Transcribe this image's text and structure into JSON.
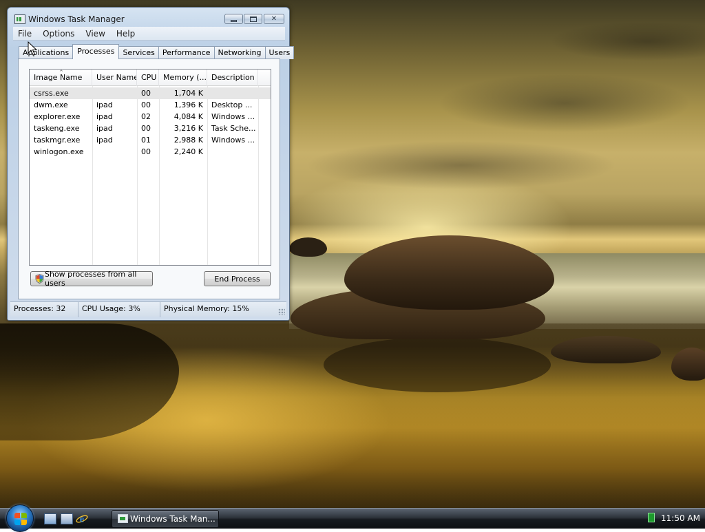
{
  "window": {
    "title": "Windows Task Manager",
    "icon": "task-manager-icon"
  },
  "menu": [
    "File",
    "Options",
    "View",
    "Help"
  ],
  "tabs": [
    {
      "label": "Applications",
      "active": false
    },
    {
      "label": "Processes",
      "active": true
    },
    {
      "label": "Services",
      "active": false
    },
    {
      "label": "Performance",
      "active": false
    },
    {
      "label": "Networking",
      "active": false
    },
    {
      "label": "Users",
      "active": false
    }
  ],
  "processes": {
    "columns": [
      "Image Name",
      "User Name",
      "CPU",
      "Memory (...",
      "Description"
    ],
    "sort_indicator": "^",
    "rows": [
      {
        "image": "csrss.exe",
        "user": "",
        "cpu": "00",
        "memory": "1,704 K",
        "description": "",
        "selected": true
      },
      {
        "image": "dwm.exe",
        "user": "ipad",
        "cpu": "00",
        "memory": "1,396 K",
        "description": "Desktop ...",
        "selected": false
      },
      {
        "image": "explorer.exe",
        "user": "ipad",
        "cpu": "02",
        "memory": "4,084 K",
        "description": "Windows ...",
        "selected": false
      },
      {
        "image": "taskeng.exe",
        "user": "ipad",
        "cpu": "00",
        "memory": "3,216 K",
        "description": "Task Sche...",
        "selected": false
      },
      {
        "image": "taskmgr.exe",
        "user": "ipad",
        "cpu": "01",
        "memory": "2,988 K",
        "description": "Windows ...",
        "selected": false
      },
      {
        "image": "winlogon.exe",
        "user": "",
        "cpu": "00",
        "memory": "2,240 K",
        "description": "",
        "selected": false
      }
    ]
  },
  "buttons": {
    "show_all": "Show processes from all users",
    "end_process": "End Process"
  },
  "status": {
    "processes": "Processes: 32",
    "cpu_usage": "CPU Usage: 3%",
    "physical_memory": "Physical Memory: 15%"
  },
  "taskbar": {
    "task_button": "Windows Task Man...",
    "clock": "11:50 AM"
  },
  "colors": {
    "accent": "#2f9a3c",
    "window_frame": "#c4d6ea",
    "taskbar": "#161a1f"
  }
}
